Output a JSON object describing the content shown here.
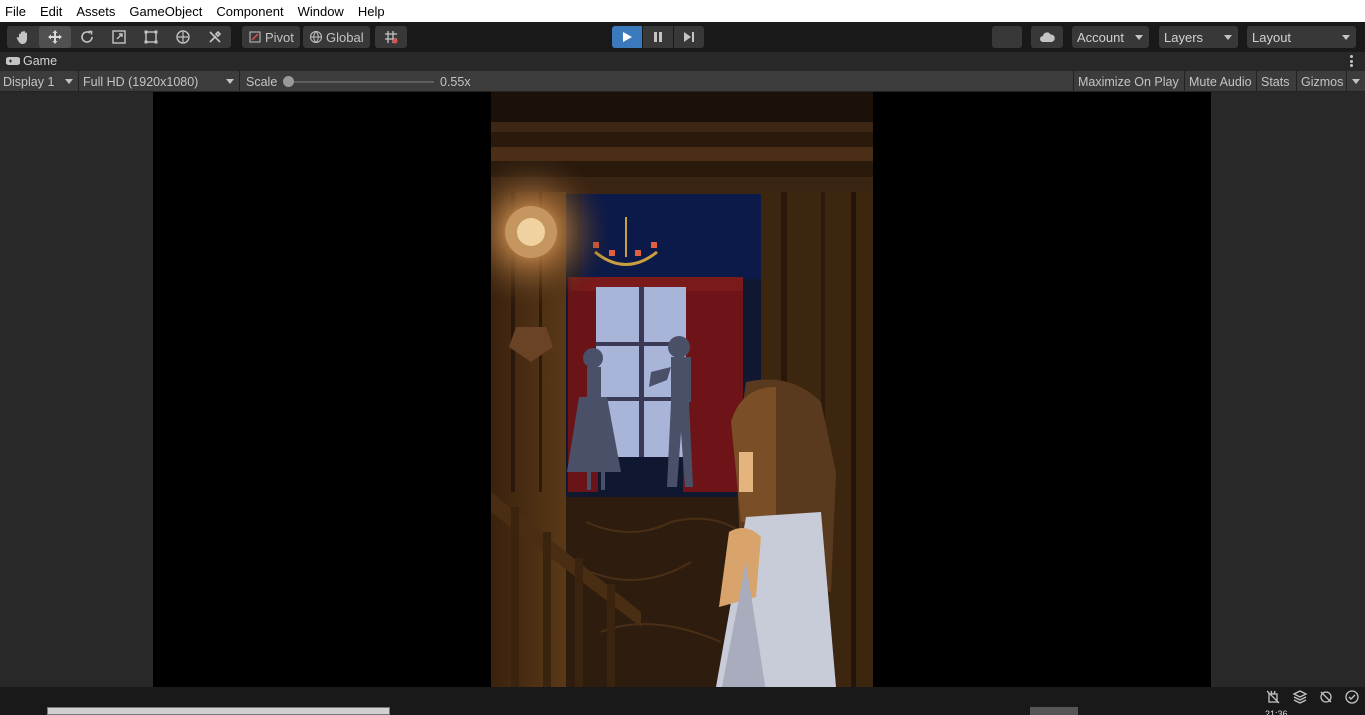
{
  "menu": [
    "File",
    "Edit",
    "Assets",
    "GameObject",
    "Component",
    "Window",
    "Help"
  ],
  "toolbar": {
    "tools": [
      {
        "name": "hand-tool",
        "icon": "hand-icon"
      },
      {
        "name": "move-tool",
        "icon": "move-icon",
        "active": true
      },
      {
        "name": "rotate-tool",
        "icon": "rotate-icon"
      },
      {
        "name": "scale-tool",
        "icon": "scale-icon"
      },
      {
        "name": "rect-tool",
        "icon": "rect-icon"
      },
      {
        "name": "transform-tool",
        "icon": "transform-icon"
      },
      {
        "name": "custom-tool",
        "icon": "tools-icon"
      }
    ],
    "pivot_label": "Pivot",
    "global_label": "Global",
    "account_label": "Account",
    "layers_label": "Layers",
    "layout_label": "Layout",
    "play_active": true
  },
  "tab": {
    "title": "Game"
  },
  "gameview": {
    "display": "Display 1",
    "resolution": "Full HD (1920x1080)",
    "scale_label": "Scale",
    "scale_value": "0.55x",
    "maximize": "Maximize On Play",
    "mute": "Mute Audio",
    "stats": "Stats",
    "gizmos": "Gizmos"
  },
  "colors": {
    "play_accent": "#3a79bb",
    "panel": "#282828",
    "toolbar": "#191919"
  },
  "status": {
    "clock_fragment": "21:36"
  }
}
